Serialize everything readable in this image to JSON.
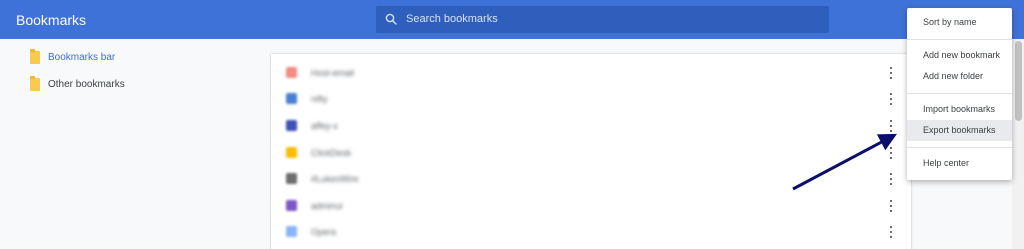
{
  "header": {
    "title": "Bookmarks",
    "search": {
      "placeholder": "Search bookmarks",
      "icon": "search-icon"
    },
    "color": "#3f72d8"
  },
  "sidebar": {
    "items": [
      {
        "label": "Bookmarks bar",
        "icon": "folder-icon",
        "active": true
      },
      {
        "label": "Other bookmarks",
        "icon": "folder-icon",
        "active": false
      }
    ]
  },
  "bookmarks": {
    "rows": [
      {
        "title": "Host-email",
        "favicon_color": "#f28b82"
      },
      {
        "title": "nifty",
        "favicon_color": "#4a7fd1"
      },
      {
        "title": "affey-x",
        "favicon_color": "#3f51b5"
      },
      {
        "title": "ClickDesk",
        "favicon_color": "#fbbc04"
      },
      {
        "title": "#LukesWire",
        "favicon_color": "#6d6d6d"
      },
      {
        "title": "adminui",
        "favicon_color": "#7e57c2"
      },
      {
        "title": "Opera",
        "favicon_color": "#8ab4f8"
      }
    ]
  },
  "menu": {
    "items": [
      {
        "label": "Sort by name",
        "highlighted": false
      },
      {
        "label": "Add new bookmark",
        "highlighted": false
      },
      {
        "label": "Add new folder",
        "highlighted": false
      },
      {
        "label": "Import bookmarks",
        "highlighted": false
      },
      {
        "label": "Export bookmarks",
        "highlighted": true
      },
      {
        "label": "Help center",
        "highlighted": false
      }
    ]
  },
  "annotation": {
    "arrow_color": "#0b0f6b"
  }
}
